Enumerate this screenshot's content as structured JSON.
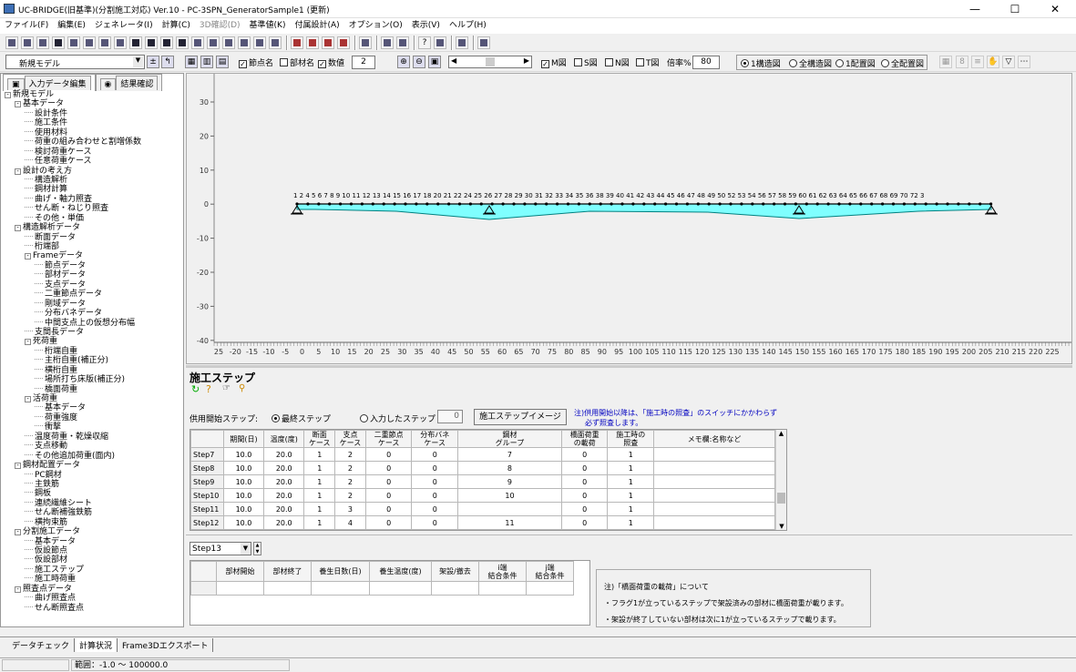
{
  "window": {
    "title": "UC-BRIDGE(旧基準)(分割施工対応) Ver.10 - PC-3SPN_GeneratorSample1 (更新)",
    "min": "—",
    "max": "☐",
    "close": "✕"
  },
  "menu": [
    "ファイル(F)",
    "編集(E)",
    "ジェネレータ(I)",
    "計算(C)",
    "3D確認(D)",
    "基準値(K)",
    "付属設計(A)",
    "オプション(O)",
    "表示(V)",
    "ヘルプ(H)"
  ],
  "toolbar2": {
    "model_select": "新規モデル",
    "node_name": "節点名",
    "member_name": "部材名",
    "value": "数値",
    "value_num": "2",
    "m_label": "M図",
    "s_label": "S図",
    "n_label": "N図",
    "t_label": "T図",
    "scale_label": "倍率%",
    "scale_value": "80",
    "r1": "1構造図",
    "r2": "全構造図",
    "r3": "1配置図",
    "r4": "全配置図"
  },
  "left_tabs": {
    "input": "入力データ編集",
    "result": "結果確認"
  },
  "tree": [
    {
      "t": "新規モデル",
      "l": 0,
      "pm": "-"
    },
    {
      "t": "基本データ",
      "l": 1,
      "pm": "-"
    },
    {
      "t": "設計条件",
      "l": 2
    },
    {
      "t": "施工条件",
      "l": 2
    },
    {
      "t": "使用材料",
      "l": 2
    },
    {
      "t": "荷重の組み合わせと割増係数",
      "l": 2
    },
    {
      "t": "検討荷重ケース",
      "l": 2
    },
    {
      "t": "任意荷重ケース",
      "l": 2
    },
    {
      "t": "設計の考え方",
      "l": 1,
      "pm": "-"
    },
    {
      "t": "構造解析",
      "l": 2
    },
    {
      "t": "鋼材計算",
      "l": 2
    },
    {
      "t": "曲げ・軸力照査",
      "l": 2
    },
    {
      "t": "せん断・ねじり照査",
      "l": 2
    },
    {
      "t": "その他・単価",
      "l": 2
    },
    {
      "t": "構造解析データ",
      "l": 1,
      "pm": "-"
    },
    {
      "t": "断面データ",
      "l": 2
    },
    {
      "t": "桁端部",
      "l": 2
    },
    {
      "t": "Frameデータ",
      "l": 2,
      "pm": "-"
    },
    {
      "t": "節点データ",
      "l": 3
    },
    {
      "t": "部材データ",
      "l": 3
    },
    {
      "t": "支点データ",
      "l": 3
    },
    {
      "t": "二重節点データ",
      "l": 3
    },
    {
      "t": "剛域データ",
      "l": 3
    },
    {
      "t": "分布バネデータ",
      "l": 3
    },
    {
      "t": "中間支点上の仮想分布幅",
      "l": 3
    },
    {
      "t": "支間長データ",
      "l": 2
    },
    {
      "t": "死荷重",
      "l": 2,
      "pm": "-"
    },
    {
      "t": "桁端自重",
      "l": 3
    },
    {
      "t": "主桁自重(補正分)",
      "l": 3
    },
    {
      "t": "横桁自重",
      "l": 3
    },
    {
      "t": "場所打ち床版(補正分)",
      "l": 3
    },
    {
      "t": "橋面荷重",
      "l": 3
    },
    {
      "t": "活荷重",
      "l": 2,
      "pm": "-"
    },
    {
      "t": "基本データ",
      "l": 3
    },
    {
      "t": "荷重強度",
      "l": 3
    },
    {
      "t": "衝撃",
      "l": 3
    },
    {
      "t": "温度荷重・乾燥収縮",
      "l": 2
    },
    {
      "t": "支点移動",
      "l": 2
    },
    {
      "t": "その他追加荷重(面内)",
      "l": 2
    },
    {
      "t": "鋼材配置データ",
      "l": 1,
      "pm": "-"
    },
    {
      "t": "PC鋼材",
      "l": 2
    },
    {
      "t": "主鉄筋",
      "l": 2
    },
    {
      "t": "鋼板",
      "l": 2
    },
    {
      "t": "連続繊維シート",
      "l": 2
    },
    {
      "t": "せん断補強鉄筋",
      "l": 2
    },
    {
      "t": "横拘束筋",
      "l": 2
    },
    {
      "t": "分割施工データ",
      "l": 1,
      "pm": "-"
    },
    {
      "t": "基本データ",
      "l": 2
    },
    {
      "t": "仮設節点",
      "l": 2
    },
    {
      "t": "仮設部材",
      "l": 2
    },
    {
      "t": "施工ステップ",
      "l": 2
    },
    {
      "t": "施工時荷重",
      "l": 2
    },
    {
      "t": "照査点データ",
      "l": 1,
      "pm": "-"
    },
    {
      "t": "曲げ照査点",
      "l": 2
    },
    {
      "t": "せん断照査点",
      "l": 2
    }
  ],
  "canvas": {
    "y_ticks": [
      "30",
      "20",
      "10",
      "0",
      "-10",
      "-20",
      "-30",
      "-40"
    ],
    "x_ticks": [
      "25",
      "-20",
      "-15",
      "-10",
      "-5",
      "0",
      "5",
      "10",
      "15",
      "20",
      "25",
      "30",
      "35",
      "40",
      "45",
      "50",
      "55",
      "60",
      "65",
      "70",
      "75",
      "80",
      "85",
      "90",
      "95",
      "100",
      "105",
      "110",
      "115",
      "120",
      "125",
      "130",
      "135",
      "140",
      "145",
      "150",
      "155",
      "160",
      "165",
      "170",
      "175",
      "180",
      "185",
      "190",
      "195",
      "200",
      "205",
      "210",
      "215",
      "220",
      "225"
    ],
    "node_labels": "1 2   4   5   6   7   8   9 10 11 12 13 14 15 16 17 18  20 21 22  24 25 26 27 28 29 30  31  32  33  34  35  36 38 39  40  41  42  43  44 45 46 47 48 49 50  52 53 54  56 57 58 59 60 61 62  63  64 65  66  67  68  69  70  72 3"
  },
  "lower": {
    "section_title": "施工ステップ",
    "open_step_label": "供用開始ステップ:",
    "radio_last": "最終ステップ",
    "radio_input": "入力したステップ",
    "input_step_value": "0",
    "image_button": "施工ステップイメージ",
    "note1a": "注)供用開始以降は、「施工時の照査」のスイッチにかかわらず",
    "note1b": "必ず照査します。",
    "headers": [
      "",
      "期間(日)",
      "温度(度)",
      "断面\nケース",
      "支点\nケース",
      "二重節点\nケース",
      "分布バネ\nケース",
      "鋼材\nグループ",
      "橋面荷重\nの載荷",
      "施工時の\n照査",
      "メモ欄:名称など"
    ],
    "rows": [
      [
        "Step7",
        "10.0",
        "20.0",
        "1",
        "2",
        "0",
        "0",
        "7",
        "0",
        "1",
        ""
      ],
      [
        "Step8",
        "10.0",
        "20.0",
        "1",
        "2",
        "0",
        "0",
        "8",
        "0",
        "1",
        ""
      ],
      [
        "Step9",
        "10.0",
        "20.0",
        "1",
        "2",
        "0",
        "0",
        "9",
        "0",
        "1",
        ""
      ],
      [
        "Step10",
        "10.0",
        "20.0",
        "1",
        "2",
        "0",
        "0",
        "10",
        "0",
        "1",
        ""
      ],
      [
        "Step11",
        "10.0",
        "20.0",
        "1",
        "3",
        "0",
        "0",
        "",
        "0",
        "1",
        ""
      ],
      [
        "Step12",
        "10.0",
        "20.0",
        "1",
        "4",
        "0",
        "0",
        "11",
        "0",
        "1",
        ""
      ]
    ],
    "step_select": "Step13",
    "sub_headers": [
      "",
      "部材開始",
      "部材終了",
      "養生日数(日)",
      "養生温度(度)",
      "架設/撤去",
      "i端\n結合条件",
      "j端\n結合条件"
    ],
    "note2_title": "注)「橋面荷重の載荷」について",
    "note2_l1": "・フラグ1が立っているステップで架設済みの部材に橋面荷重が載ります。",
    "note2_l2": "・架設が終了していない部材は次に1が立っているステップで載ります。"
  },
  "bottom_tabs": [
    "データチェック",
    "計算状況",
    "Frame3Dエクスポート"
  ],
  "status": {
    "range": "範囲：-1.0 〜 100000.0"
  }
}
